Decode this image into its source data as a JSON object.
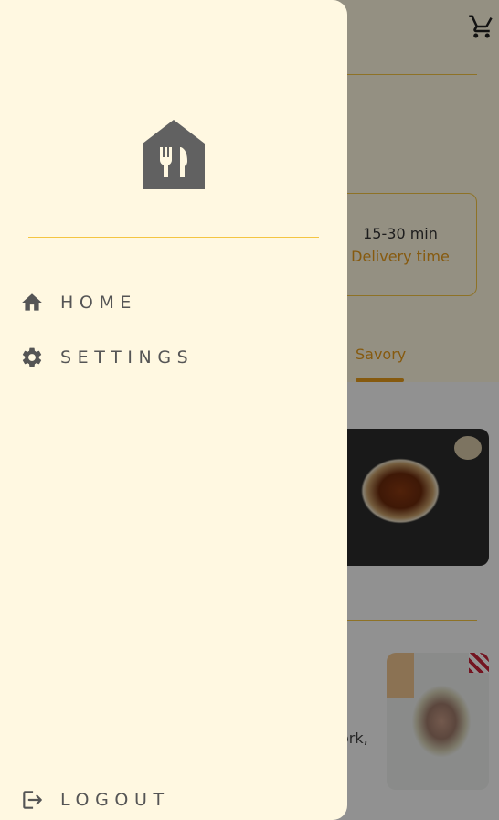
{
  "background": {
    "delivery": {
      "time": "15-30 min",
      "label": "Delivery time"
    },
    "tab": {
      "label": "Savory"
    },
    "description_fragment": "ork,"
  },
  "drawer": {
    "logo_icon": "restaurant-house-icon",
    "items": [
      {
        "label": "HOME",
        "icon": "home-icon"
      },
      {
        "label": "SETTINGS",
        "icon": "gear-icon"
      }
    ],
    "logout": {
      "label": "LOGOUT",
      "icon": "logout-icon"
    }
  },
  "colors": {
    "drawer_bg": "#fff8e1",
    "accent": "#e79b1a",
    "divider": "#f4c542",
    "icon": "#555555"
  }
}
